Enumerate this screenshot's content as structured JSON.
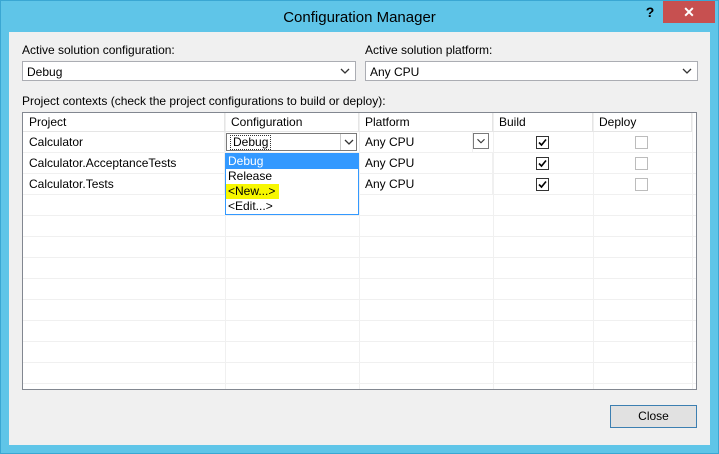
{
  "window": {
    "title": "Configuration Manager",
    "help_glyph": "?",
    "close_glyph": "✕"
  },
  "solution_config": {
    "label": "Active solution configuration:",
    "value": "Debug"
  },
  "solution_platform": {
    "label": "Active solution platform:",
    "value": "Any CPU"
  },
  "project_contexts": {
    "label": "Project contexts (check the project configurations to build or deploy):",
    "headers": [
      "Project",
      "Configuration",
      "Platform",
      "Build",
      "Deploy"
    ],
    "rows": [
      {
        "project": "Calculator",
        "configuration": "Debug",
        "platform": "Any CPU",
        "build": true,
        "deploy": false
      },
      {
        "project": "Calculator.AcceptanceTests",
        "configuration": "",
        "platform": "Any CPU",
        "build": true,
        "deploy": false
      },
      {
        "project": "Calculator.Tests",
        "configuration": "",
        "platform": "Any CPU",
        "build": true,
        "deploy": false
      }
    ]
  },
  "config_dropdown": {
    "options": [
      "Debug",
      "Release",
      "<New...>",
      "<Edit...>"
    ],
    "selected": "Debug",
    "highlighted": "<New...>"
  },
  "buttons": {
    "close": "Close"
  },
  "colors": {
    "title_bg": "#5fc5e8",
    "close_bg": "#c75050",
    "selection": "#3399ff",
    "highlight": "#f7f700"
  }
}
